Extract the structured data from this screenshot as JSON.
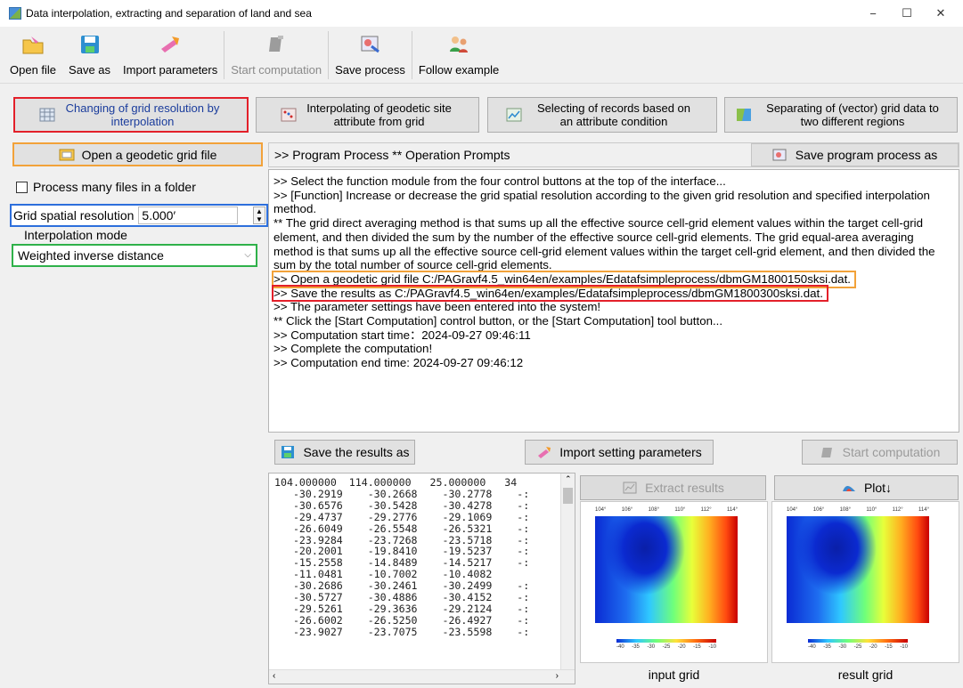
{
  "window": {
    "title": "Data interpolation, extracting and separation of land and sea",
    "minimize": "−",
    "maximize": "☐",
    "close": "✕"
  },
  "toolbar": {
    "open_file": "Open file",
    "save_as": "Save as",
    "import_parameters": "Import parameters",
    "start_computation": "Start computation",
    "save_process": "Save process",
    "follow_example": "Follow example"
  },
  "modules": {
    "changing_grid": "Changing of grid resolution by interpolation",
    "interpolating_site": "Interpolating of geodetic site attribute from grid",
    "selecting_records": "Selecting of records based on an attribute condition",
    "separating_grid": "Separating of (vector) grid data to two different regions"
  },
  "left": {
    "open_grid_button": "Open a geodetic grid file",
    "process_many": "Process many files in a folder",
    "grid_res_label": "Grid spatial resolution",
    "grid_res_value": "5.000′",
    "interp_label": "Interpolation mode",
    "interp_value": "Weighted inverse distance"
  },
  "process": {
    "header": ">> Program Process  ** Operation Prompts",
    "save_button": "Save program process as",
    "log": [
      ">> Select the function module from the four control buttons at the top of the interface...",
      ">> [Function] Increase or decrease the grid spatial resolution according to the given grid resolution and specified interpolation method.",
      "  ** The grid direct averaging method is that sums up all the effective source cell-grid element values within the target cell-grid element, and then divided the sum by the number of the effective source cell-grid elements. The grid equal-area averaging method is that sums up all the effective source cell-grid element values within the target cell-grid element, and then divided the sum by the total number of source cell-grid elements.",
      ">> Open a geodetic grid file C:/PAGravf4.5_win64en/examples/Edatafsimpleprocess/dbmGM1800150sksi.dat.",
      ">> Save the results as C:/PAGravf4.5_win64en/examples/Edatafsimpleprocess/dbmGM1800300sksi.dat.",
      ">> The parameter settings have been entered into the system!",
      "  ** Click the [Start Computation] control button, or the [Start Computation] tool button...",
      ">> Computation start time：2024-09-27 09:46:11",
      ">> Complete the computation!",
      ">> Computation end time: 2024-09-27 09:46:12"
    ]
  },
  "actions": {
    "save_results": "Save the results as",
    "import_setting": "Import setting parameters",
    "start_computation": "Start computation",
    "extract_results": "Extract results",
    "plot": "Plot↓"
  },
  "data_rows": [
    "104.000000  114.000000   25.000000   34",
    "   -30.2919    -30.2668    -30.2778    -:",
    "   -30.6576    -30.5428    -30.4278    -:",
    "   -29.4737    -29.2776    -29.1069    -:",
    "   -26.6049    -26.5548    -26.5321    -:",
    "   -23.9284    -23.7268    -23.5718    -:",
    "   -20.2001    -19.8410    -19.5237    -:",
    "   -15.2558    -14.8489    -14.5217    -:",
    "   -11.0481    -10.7002    -10.4082     ",
    "   -30.2686    -30.2461    -30.2499    -:",
    "   -30.5727    -30.4886    -30.4152    -:",
    "   -29.5261    -29.3636    -29.2124    -:",
    "   -26.6002    -26.5250    -26.4927    -:",
    "   -23.9027    -23.7075    -23.5598    -:"
  ],
  "maps": {
    "input_label": "input grid",
    "result_label": "result grid",
    "x_ticks": [
      "104°",
      "106°",
      "108°",
      "110°",
      "112°",
      "114°"
    ],
    "scale_ticks": [
      "-40",
      "-35",
      "-30",
      "-25",
      "-20",
      "-15",
      "-10"
    ]
  },
  "colors": {
    "red": "#e3202a",
    "orange": "#f2a23a",
    "blue": "#2d6fdc",
    "green": "#2fb14a"
  }
}
